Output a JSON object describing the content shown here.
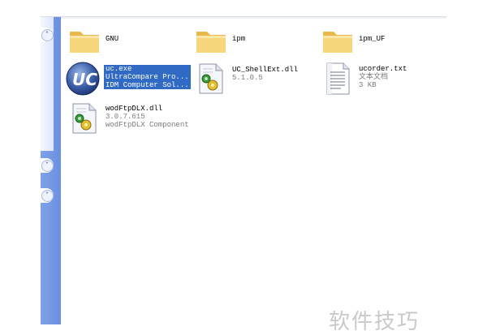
{
  "colors": {
    "task_pane": "#7ea2e8",
    "selection": "#316ac5",
    "folder": "#f5d37a",
    "secondary_text": "#7a7a7a"
  },
  "task_pane": {
    "buttons": [
      {
        "icon": "chevron-up-icon",
        "glyph": "˄"
      },
      {
        "icon": "chevron-down-icon",
        "glyph": "˅"
      },
      {
        "icon": "chevron-down-icon",
        "glyph": "˅"
      }
    ]
  },
  "items": [
    {
      "name": "GNU",
      "icon": "folder-icon"
    },
    {
      "name": "ipm",
      "icon": "folder-icon"
    },
    {
      "name": "ipm_UF",
      "icon": "folder-icon"
    },
    {
      "name": "uc.exe",
      "line2": "UltraCompare Pro...",
      "line3": "IDM Computer Sol...",
      "icon": "ultracompare-app-icon",
      "selected": true
    },
    {
      "name": "UC_ShellExt.dll",
      "line2": "5.1.0.5",
      "icon": "dll-file-icon"
    },
    {
      "name": "ucorder.txt",
      "line2": "文本文档",
      "line3": "3 KB",
      "icon": "text-file-icon"
    },
    {
      "name": "wodFtpDLX.dll",
      "line2": "3.0.7.615",
      "line3": "wodFtpDLX Component",
      "icon": "dll-file-icon"
    }
  ],
  "watermark": "软件技巧"
}
